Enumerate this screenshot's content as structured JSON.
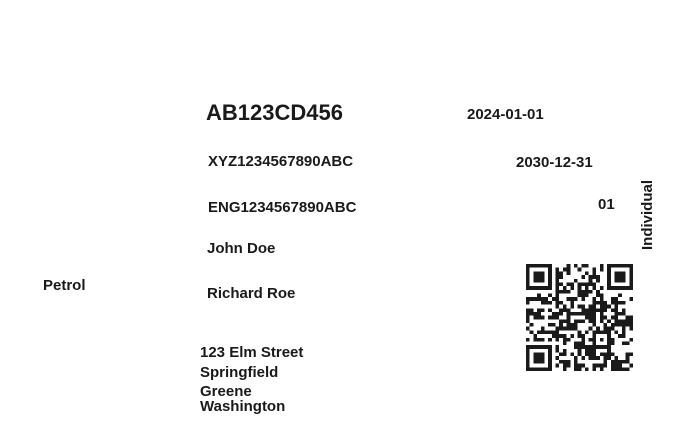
{
  "vehicle": {
    "registration_number": "AB123CD456",
    "registration_date": "2024-01-01",
    "chassis_number": "XYZ1234567890ABC",
    "valid_upto": "2030-12-31",
    "engine_number": "ENG1234567890ABC",
    "owner_serial": "01",
    "ownership_type": "Individual",
    "owner_name": "John Doe",
    "fuel_type": "Petrol",
    "guardian_name": "Richard Roe"
  },
  "address": {
    "street": "123 Elm Street",
    "city": "Springfield",
    "county": "Greene",
    "state": "Washington"
  },
  "qr_code": {
    "icon": "qr-code-icon",
    "color": "#1a1a1a"
  }
}
